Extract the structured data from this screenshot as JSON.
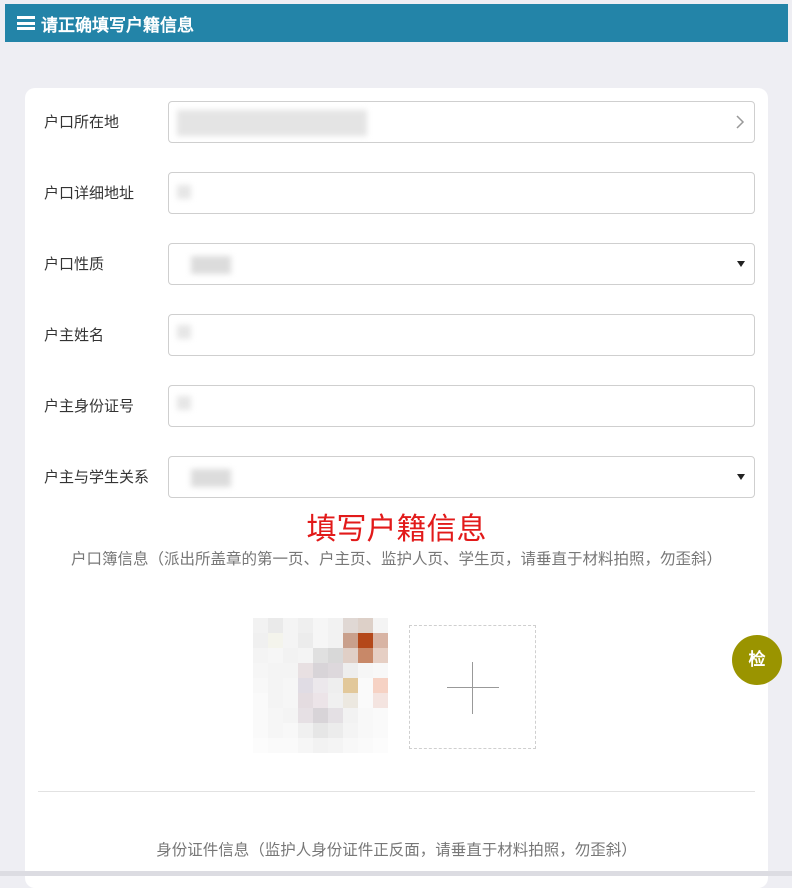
{
  "header": {
    "title": "请正确填写户籍信息",
    "menu_icon": "hamburger-menu-icon"
  },
  "form": {
    "fields": [
      {
        "label": "户口所在地",
        "type": "picker",
        "value": ""
      },
      {
        "label": "户口详细地址",
        "type": "text",
        "value": ""
      },
      {
        "label": "户口性质",
        "type": "select",
        "value": ""
      },
      {
        "label": "户主姓名",
        "type": "text",
        "value": ""
      },
      {
        "label": "户主身份证号",
        "type": "text",
        "value": ""
      },
      {
        "label": "户主与学生关系",
        "type": "select",
        "value": ""
      }
    ]
  },
  "annotation": {
    "text": "填写户籍信息",
    "color": "#e21a1a"
  },
  "household_book": {
    "help_text": "户口簿信息（派出所盖章的第一页、户主页、监护人页、学生页，请垂直于材料拍照，勿歪斜）"
  },
  "id_card": {
    "help_text": "身份证件信息（监护人身份证件正反面，请垂直于材料拍照，勿歪斜）"
  },
  "check_button": {
    "label": "检",
    "color": "#9a9400"
  },
  "colors": {
    "header": "#2384a8",
    "page_bg": "#eeeef3"
  }
}
